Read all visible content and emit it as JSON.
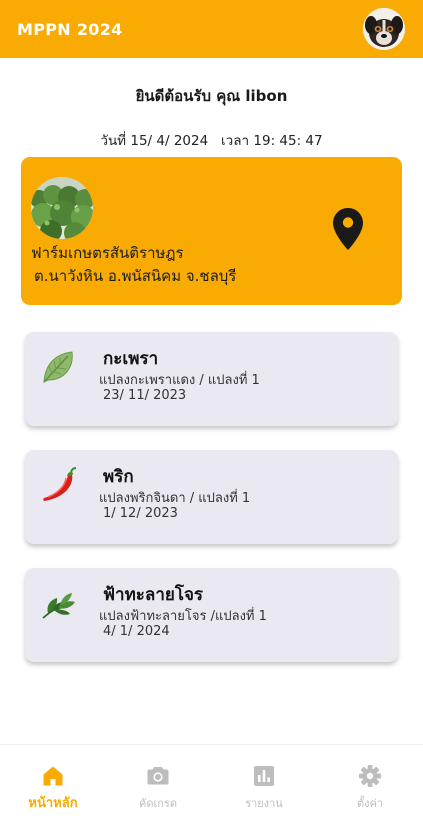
{
  "app": {
    "title": "MPPN 2024"
  },
  "colors": {
    "accent": "#f9ab04",
    "card": "#eae9f2",
    "inactive": "#bdbdbd"
  },
  "greeting": "ยินดีต้อนรับ คุณ libon",
  "datetime": "วันที่ 15/ 4/ 2024   เวลา 19: 45: 47",
  "farm": {
    "name": "ฟาร์มเกษตรสันติราษฎร",
    "location": "ต.นาวังหิน อ.พนัสนิคม จ.ชลบุรี",
    "photo_icon": "farm-photo",
    "pin_icon": "location-pin-icon"
  },
  "plots": [
    {
      "name": "กะเพรา",
      "subtitle": "แปลงกะเพราแดง / แปลงที่ 1",
      "date": "23/ 11/ 2023",
      "icon": "basil-leaf-icon"
    },
    {
      "name": "พริก",
      "subtitle": "แปลงพริกจินดา / แปลงที่ 1",
      "date": "1/ 12/ 2023",
      "icon": "chili-icon"
    },
    {
      "name": "ฟ้าทะลายโจร",
      "subtitle": "แปลงฟ้าทะลายโจร /แปลงที่ 1",
      "date": "4/ 1/ 2024",
      "icon": "herb-icon"
    }
  ],
  "nav": [
    {
      "label": "หน้าหลัก",
      "icon": "home-icon",
      "active": true
    },
    {
      "label": "คัดเกรด",
      "icon": "camera-icon",
      "active": false
    },
    {
      "label": "รายงาน",
      "icon": "report-chart-icon",
      "active": false
    },
    {
      "label": "ตั้งค่า",
      "icon": "gear-icon",
      "active": false
    }
  ]
}
